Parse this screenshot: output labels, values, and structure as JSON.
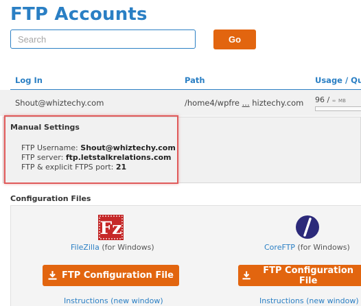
{
  "page": {
    "title": "FTP Accounts"
  },
  "search": {
    "placeholder": "Search",
    "go_label": "Go"
  },
  "table": {
    "headers": [
      "Log In",
      "Path",
      "Usage / Quo"
    ],
    "row": {
      "login": "Shout@whiztechy.com",
      "path_start": "/home4/wpfre",
      "path_ellipsis": "...",
      "path_end": "hiztechy.com",
      "usage_value": "96 / ",
      "usage_infinity": "∞",
      "usage_unit": "MB"
    }
  },
  "manual": {
    "title": "Manual Settings",
    "username_label": "FTP Username:",
    "username_value": "Shout@whiztechy.com",
    "server_label": "FTP server:",
    "server_value": "ftp.letstalkrelations.com",
    "port_label": "FTP & explicit FTPS port:",
    "port_value": "21"
  },
  "config": {
    "title": "Configuration Files",
    "clients": [
      {
        "name": "FileZilla",
        "suffix": " (for Windows)",
        "button": "FTP Configuration File",
        "instructions": "Instructions (new window)",
        "icon": "filezilla-icon"
      },
      {
        "name": "CoreFTP",
        "suffix": " (for Windows)",
        "button": "FTP Configuration File",
        "instructions": "Instructions (new window)",
        "icon": "coreftp-icon"
      }
    ]
  },
  "colors": {
    "accent": "#2a7fc4",
    "button": "#e2650f",
    "highlight": "#e05a5a"
  }
}
